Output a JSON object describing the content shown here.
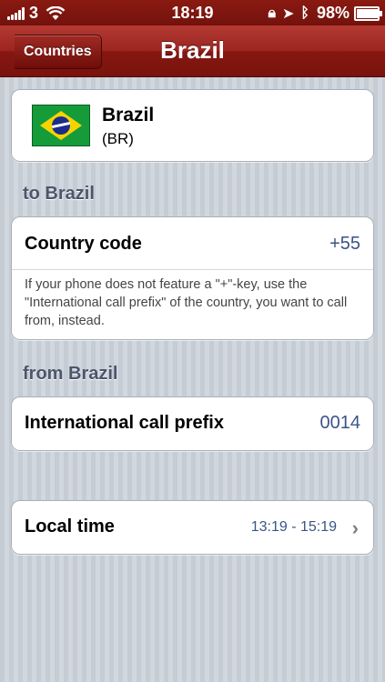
{
  "status_bar": {
    "carrier": "3",
    "time": "18:19",
    "battery": "98%",
    "battery_level": 0.98
  },
  "nav": {
    "back_label": "Countries",
    "title": "Brazil"
  },
  "country": {
    "name": "Brazil",
    "iso": "(BR)",
    "flag_icon": "brazil-flag-icon"
  },
  "sections": {
    "to_header": "to Brazil",
    "from_header": "from Brazil"
  },
  "country_code": {
    "label": "Country code",
    "value": "+55",
    "note": "If your phone does not feature a \"+\"-key, use the \"International call prefix\" of the country, you want to call from, instead."
  },
  "international_prefix": {
    "label": "International call prefix",
    "value": "0014"
  },
  "local_time": {
    "label": "Local time",
    "value": "13:19 - 15:19"
  },
  "colors": {
    "nav_red": "#9c2520",
    "value_blue": "#3b5488",
    "section_text": "#4c566c"
  }
}
